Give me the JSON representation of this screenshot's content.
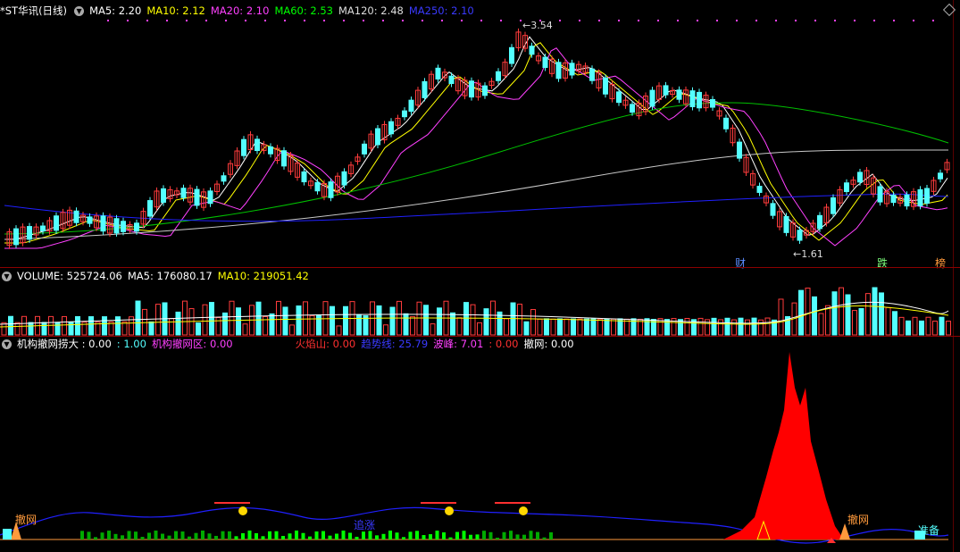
{
  "main": {
    "title": "*ST华讯(日线)",
    "ma5": "MA5: 2.20",
    "ma10": "MA10: 2.12",
    "ma20": "MA20: 2.10",
    "ma60": "MA60: 2.53",
    "ma120": "MA120: 2.48",
    "ma250": "MA250: 2.10",
    "high_label": "3.54",
    "low_label": "1.61",
    "tags": [
      "财",
      "跌",
      "榜"
    ]
  },
  "volume": {
    "label": "VOLUME: 525724.06",
    "ma5": "MA5: 176080.17",
    "ma10": "MA10: 219051.42"
  },
  "indicator": {
    "i1": "机构撤网捞大 : 0.00",
    "i2": ": 1.00",
    "i3": "机构撤网区: 0.00",
    "i4": "火焰山: 0.00",
    "i5": "趋势线: 25.79",
    "i6": "波峰: 7.01",
    "i7": ": 0.00",
    "i8": "撤网: 0.00",
    "text_left": "撤网",
    "text_mid": "追涨",
    "text_right": "撤网",
    "text_ready": "准备"
  },
  "colors": {
    "up": "#ff3c3c",
    "down": "#54ffff",
    "ma5": "#ffffff",
    "ma10": "#ffff00",
    "ma20": "#ff40ff",
    "ma60": "#00c000",
    "ma120": "#c8c8c8",
    "ma250": "#2020ff"
  }
}
